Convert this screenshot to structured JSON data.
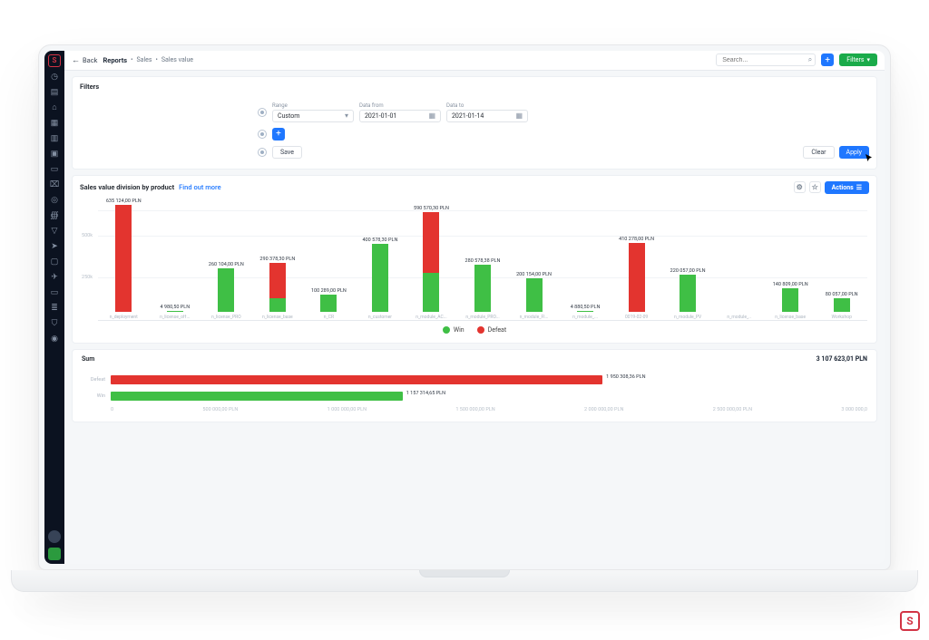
{
  "search": {
    "placeholder": "Search..."
  },
  "topbar": {
    "back": "Back",
    "crumb_root": "Reports",
    "crumb_1": "Sales",
    "crumb_2": "Sales value",
    "filters_btn": "Filters"
  },
  "filters": {
    "title": "Filters",
    "range_label": "Range",
    "range_value": "Custom",
    "from_label": "Data from",
    "from_value": "2021-01-01",
    "to_label": "Data to",
    "to_value": "2021-01-14",
    "save": "Save",
    "clear": "Clear",
    "apply": "Apply"
  },
  "chart1": {
    "title": "Sales value division by product",
    "find_out": "Find out more",
    "actions": "Actions",
    "legend_win": "Win",
    "legend_def": "Defeat"
  },
  "chart2": {
    "title": "Sum",
    "total": "3 107 623,01 PLN"
  },
  "chart_data": [
    {
      "type": "bar",
      "stacked": true,
      "title": "Sales value division by product",
      "ylabel": "",
      "ylim": [
        0,
        700
      ],
      "unit": "PLN",
      "categories": [
        "n_deployment",
        "n_license_off...",
        "n_license_PRO",
        "n_license_base",
        "n_CR",
        "n_customer",
        "n_module_AC...",
        "n_module_PRO...",
        "n_module_Fl...",
        "n_module_...",
        "0019-02-09",
        "n_module_PV",
        "n_module_..",
        "n_license_base",
        "Workshop"
      ],
      "series": [
        {
          "name": "Win",
          "values": [
            0,
            4.98,
            260.1,
            80,
            100.29,
            400.58,
            230,
            280.58,
            200.15,
            4.88,
            0,
            220.05,
            0,
            140.8,
            80.06
          ]
        },
        {
          "name": "Defeat",
          "values": [
            635.12,
            0,
            0,
            210.38,
            0,
            0,
            360.57,
            0,
            0,
            0,
            410.28,
            0,
            0,
            0,
            0
          ]
        }
      ],
      "value_labels": [
        "635 124,00 PLN",
        "4 980,50 PLN",
        "260 104,00 PLN",
        "290 378,30 PLN",
        "100 289,00 PLN",
        "400 578,30 PLN",
        "590 570,30 PLN",
        "280 578,38 PLN",
        "200 154,00 PLN",
        "4 880,50 PLN",
        "410 278,00 PLN",
        "220 057,00 PLN",
        "",
        "140 809,00 PLN",
        "80 057,00 PLN"
      ]
    },
    {
      "type": "bar",
      "orientation": "horizontal",
      "title": "Sum",
      "xlim": [
        0,
        3000000
      ],
      "x_ticks": [
        "0",
        "500 000,00 PLN",
        "1 000 000,00 PLN",
        "1 500 000,00 PLN",
        "2 000 000,00 PLN",
        "2 500 000,00 PLN",
        "3 000 000,0"
      ],
      "categories": [
        "Defeat",
        "Win"
      ],
      "values": [
        1950308.36,
        1157314.65
      ],
      "value_labels": [
        "1 950 308,36 PLN",
        "1 157 314,65 PLN"
      ],
      "colors": [
        "#e3342f",
        "#3fbf45"
      ]
    }
  ]
}
